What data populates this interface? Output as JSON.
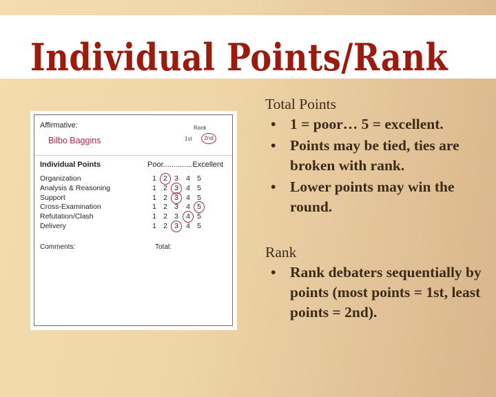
{
  "title": "Individual Points/Rank",
  "ballot": {
    "affirmative_label": "Affirmative:",
    "debater_name": "Bilbo Baggins",
    "rank_label": "Rank",
    "rank_options": [
      "1st",
      "2nd"
    ],
    "selected_rank": "2nd",
    "section_heading": "Individual Points",
    "scale_label": "Poor..............Excellent",
    "score_values": [
      "1",
      "2",
      "3",
      "4",
      "5"
    ],
    "criteria": [
      {
        "name": "Organization",
        "selected": 2
      },
      {
        "name": "Analysis & Reasoning",
        "selected": 3
      },
      {
        "name": "Support",
        "selected": 3
      },
      {
        "name": "Cross-Examination",
        "selected": 5
      },
      {
        "name": "Refutation/Clash",
        "selected": 4
      },
      {
        "name": "Delivery",
        "selected": 3
      }
    ],
    "comments_label": "Comments:",
    "total_label": "Total:"
  },
  "total_points": {
    "heading": "Total Points",
    "bullets": [
      "1 = poor… 5 = excellent.",
      "Points may be tied, ties are broken with rank.",
      "Lower points may win the round."
    ]
  },
  "rank": {
    "heading": "Rank",
    "bullets": [
      "Rank debaters sequentially by points (most points = 1st, least points = 2nd)."
    ]
  },
  "bullet_glyph": "•",
  "colors": {
    "title": "#9a1c0e",
    "body_text": "#3b2a17",
    "ballot_accent": "#a8284a"
  }
}
